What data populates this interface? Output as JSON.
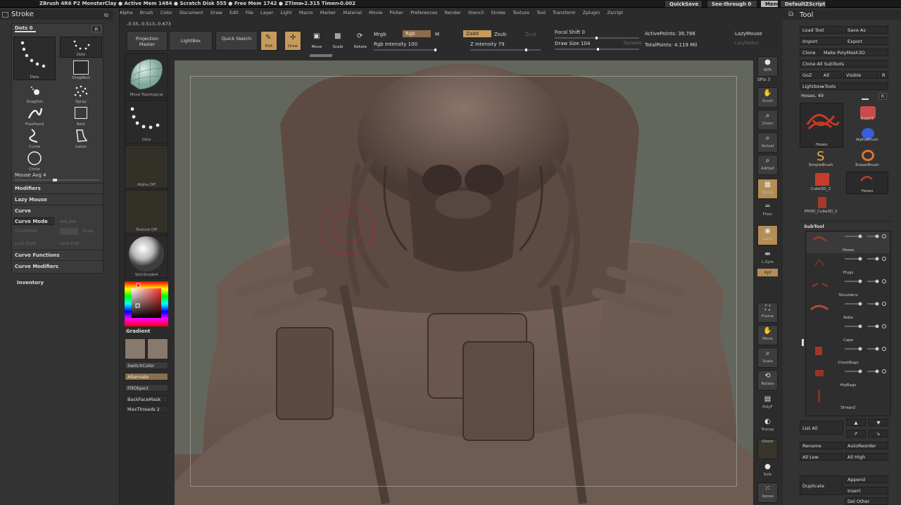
{
  "titlebar": {
    "stats": "ZBrush 4R6 P2   MonsterClay  ● Active Mem 1484 ● Scratch Disk 555 ● Free Mem 1742 ● ZTime▸2.315 Timer▸0.002",
    "quicksave": "QuickSave",
    "seethrough": "See-through  0",
    "menus": "Menus",
    "script": "DefaultZScript"
  },
  "menubar": [
    "Alpha",
    "Brush",
    "Color",
    "Document",
    "Draw",
    "Edit",
    "File",
    "Layer",
    "Light",
    "Macro",
    "Marker",
    "Material",
    "Movie",
    "Picker",
    "Preferences",
    "Render",
    "Stencil",
    "Stroke",
    "Texture",
    "Tool",
    "Transform",
    "Zplugin",
    "Zscript"
  ],
  "coords": "-0.55,-0.513,-0.673",
  "stroke": {
    "title": "Stroke",
    "dots_label": "Dots 0",
    "r_label": "R",
    "tiles": [
      "Dots",
      "Dots",
      "DragDot",
      "Spray",
      "FreeHand",
      "Rect",
      "Curve",
      "Lasso",
      "Circle",
      "DragRect"
    ],
    "mouse_avg": "Mouse Avg 4",
    "modifiers": "Modifiers",
    "lazy_mouse": "Lazy Mouse",
    "curve": "Curve",
    "curve_mode": "Curve Mode",
    "as_line": "AsLine",
    "curve_step": "CurveStep",
    "snap": "Snap",
    "lock_start": "Lock Start",
    "lock_end": "Lock End",
    "curve_functions": "Curve Functions",
    "curve_modifiers": "Curve Modifiers",
    "inventory": "Inventory"
  },
  "shelf": {
    "brush": "Move Topological",
    "stroke": "Dots",
    "alpha": "Alpha Off",
    "texture": "Texture Off",
    "material": "SkinShade4",
    "gradient": "Gradient",
    "switch_color": "SwitchColor",
    "alternate": "Alternate",
    "fill_object": "FillObject",
    "backface": "BackFaceMask",
    "max_threads": "MaxThreads 2"
  },
  "toolbar": {
    "projection_master": "Projection Master",
    "lightbox": "LightBox",
    "quick_sketch": "Quick Sketch",
    "edit": "Edit",
    "draw": "Draw",
    "move": "Move",
    "scale": "Scale",
    "rotate": "Rotate",
    "mrgb": "Mrgb",
    "rgb": "Rgb",
    "m": "M",
    "rgb_intensity": "Rgb Intensity 100",
    "zadd": "Zadd",
    "zsub": "Zsub",
    "zcut": "Zcut",
    "z_intensity": "Z Intensity 79",
    "focal_shift": "Focal Shift 0",
    "draw_size": "Draw Size 104",
    "dynamic": "Dynamic",
    "active_points": "ActivePoints: 38,788",
    "total_points": "TotalPoints: 4.119 Mil",
    "lazymouse": "LazyMouse",
    "lazyradius": "LazyRadius"
  },
  "rightcol": [
    "BPR",
    "SPix 3",
    "Scroll",
    "Zoom",
    "Actual",
    "AAHalf",
    "Persp",
    "Floor",
    "Local",
    "L.Sym",
    "xyz",
    "Frame",
    "Move",
    "Scale",
    "Rotate",
    "PolyF",
    "Transp",
    "Ghost",
    "Solo",
    "Xpose"
  ],
  "tool": {
    "title": "Tool",
    "load_tool": "Load Tool",
    "save_as": "Save As",
    "import": "Import",
    "export": "Export",
    "clone": "Clone",
    "make_polymesh": "Make PolyMesh3D",
    "clone_all": "Clone All SubTools",
    "goz": "GoZ",
    "all": "All",
    "visible": "Visible",
    "r": "R",
    "lightbox_tools": "Lightbox▸Tools",
    "hoses": "Hoses. 49",
    "thumbs": [
      "Hoses",
      "BagD3",
      "AlphaBrush",
      "SimpleBrush",
      "EraserBrush",
      "Cube3D_2",
      "Hoses",
      "PM3D_Cube3D_2"
    ],
    "subtool": "SubTool",
    "subtools": [
      "Hoses",
      "Plugs",
      "Shoulders",
      "Robe",
      "Cape",
      "ChestBags",
      "HipBags",
      "Straps2"
    ],
    "list_all": "List All",
    "rename": "Rename",
    "autoreorder": "AutoReorder",
    "all_low": "All Low",
    "all_high": "All High",
    "duplicate": "Duplicate",
    "append": "Append",
    "insert": "Insert",
    "del_other": "Del Other"
  }
}
